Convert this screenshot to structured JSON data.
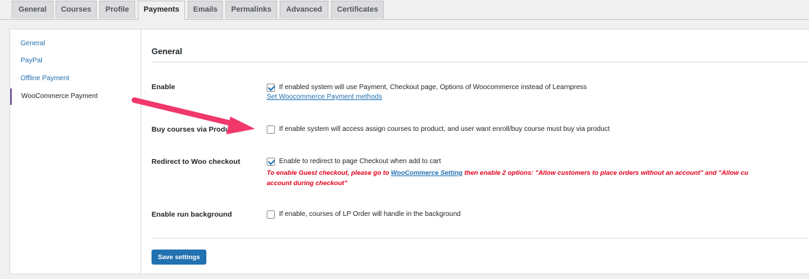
{
  "tabs": [
    {
      "label": "General"
    },
    {
      "label": "Courses"
    },
    {
      "label": "Profile"
    },
    {
      "label": "Payments",
      "active": true
    },
    {
      "label": "Emails"
    },
    {
      "label": "Permalinks"
    },
    {
      "label": "Advanced"
    },
    {
      "label": "Certificates"
    }
  ],
  "sidebar": {
    "items": [
      {
        "label": "General"
      },
      {
        "label": "PayPal"
      },
      {
        "label": "Offline Payment"
      },
      {
        "label": "WooCommerce Payment",
        "active": true
      }
    ]
  },
  "main": {
    "section_title": "General",
    "rows": {
      "enable": {
        "label": "Enable",
        "checked": true,
        "description": "If enabled system will use Payment, Checkout page, Options of Woocommerce instead of Learnpress",
        "link": "Set Woocommerce Payment methods"
      },
      "buy_via_product": {
        "label": "Buy courses via Product",
        "checked": false,
        "description": "If enable system will access assign courses to product, and user want enroll/buy course must buy via product"
      },
      "redirect": {
        "label": "Redirect to Woo checkout",
        "checked": true,
        "description": "Enable to redirect to page Checkout when add to cart",
        "warning_prefix": "To enable Guest checkout, please go to ",
        "warning_link": "WooCommerce Setting",
        "warning_suffix": " then enable 2 options: \"Allow customers to place orders without an account\" and \"Allow cu",
        "warning_line2": "account during checkout\""
      },
      "run_background": {
        "label": "Enable run background",
        "checked": false,
        "description": "If enable, courses of LP Order will handle in the background"
      }
    },
    "save_label": "Save settings"
  },
  "colors": {
    "accent": "#2271b1",
    "warning": "#e2001a",
    "annotation_arrow": "#f0386b",
    "active_nav_border": "#5b3a8f"
  }
}
